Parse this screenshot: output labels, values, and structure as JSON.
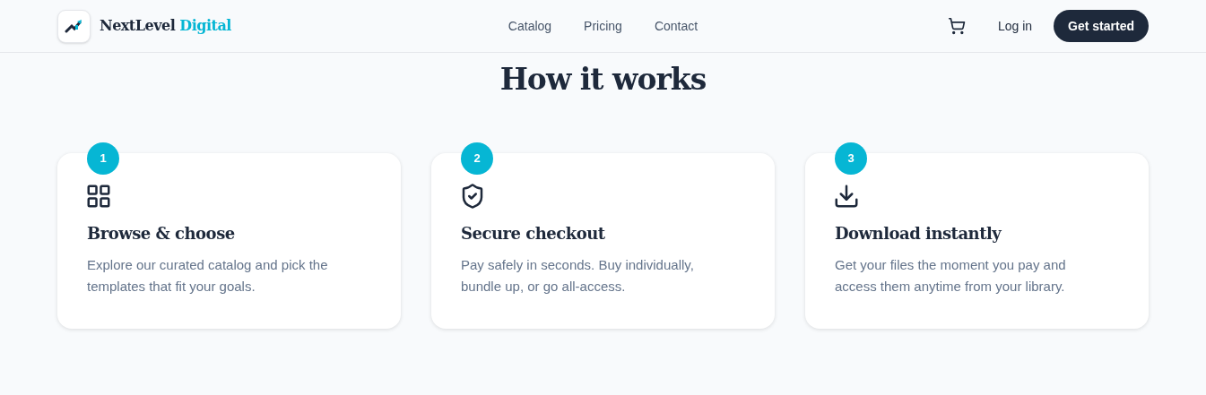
{
  "brand": {
    "name": "NextLevel",
    "accent": "Digital"
  },
  "nav": [
    {
      "label": "Catalog"
    },
    {
      "label": "Pricing"
    },
    {
      "label": "Contact"
    }
  ],
  "actions": {
    "login": "Log in",
    "cta": "Get started"
  },
  "section": {
    "title": "How it works"
  },
  "steps": [
    {
      "number": "1",
      "title": "Browse & choose",
      "text": "Explore our curated catalog and pick the templates that fit your goals."
    },
    {
      "number": "2",
      "title": "Secure checkout",
      "text": "Pay safely in seconds. Buy individually, bundle up, or go all-access."
    },
    {
      "number": "3",
      "title": "Download instantly",
      "text": "Get your files the moment you pay and access them anytime from your library."
    }
  ]
}
